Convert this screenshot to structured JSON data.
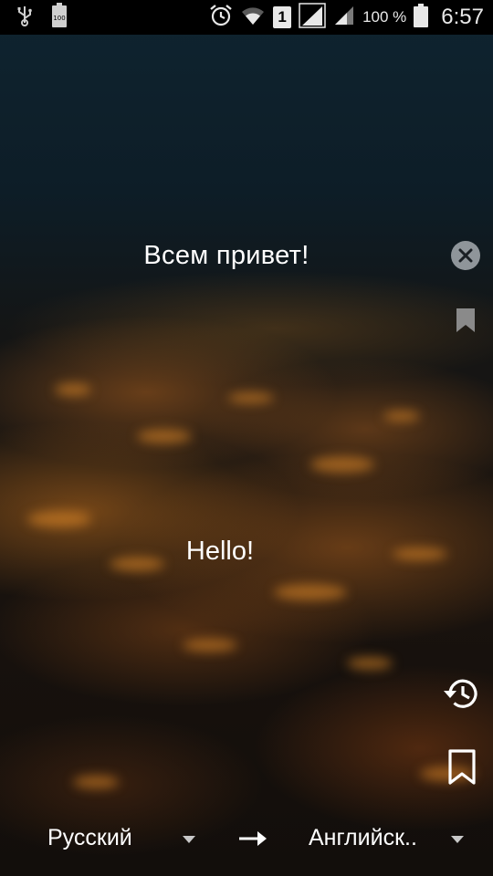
{
  "status_bar": {
    "battery_small_label": "100",
    "sim_slot": "1",
    "battery_percent": "100 %",
    "time": "6:57"
  },
  "translator": {
    "source_text": "Всем привет!",
    "translated_text": "Hello!"
  },
  "languages": {
    "source": "Русский",
    "target": "Английск.."
  },
  "icons": {
    "clear": "close-icon",
    "bookmark_source": "bookmark-filled-icon",
    "history": "history-icon",
    "bookmarks": "bookmark-outline-icon",
    "swap": "arrow-right-icon"
  },
  "colors": {
    "status_bar": "#000000",
    "text": "#ffffff",
    "clear_button": "#8f959a",
    "muted_icon": "#8a8a8a"
  }
}
